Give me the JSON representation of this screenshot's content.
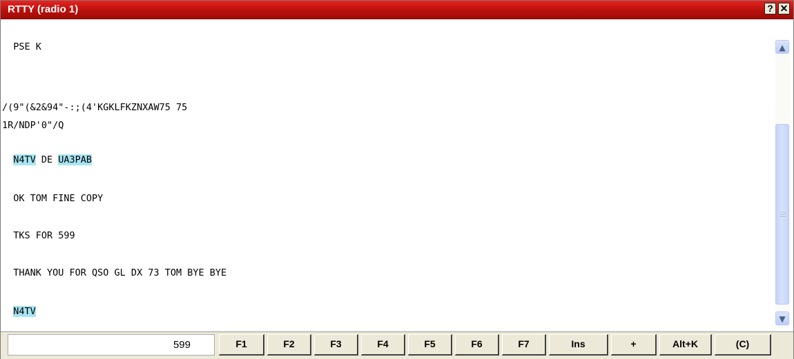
{
  "window": {
    "title": "RTTY (radio 1)",
    "help_glyph": "?",
    "close_glyph": "✕"
  },
  "receive_text": {
    "lines": [
      "  PSE K",
      "",
      "/(9\"(&2&94\"-:;(4'KGKLFKZNXAW75 75",
      "1R/NDP'0\"/Q",
      "",
      "  N4TV DE UA3PAB",
      "",
      "  OK TOM FINE COPY",
      "",
      "  TKS FOR 599",
      "",
      "  THANK YOU FOR QSO GL DX 73 TOM BYE BYE",
      "",
      "  N4TV"
    ],
    "highlighted_callsigns": [
      "N4TV",
      "UA3PAB"
    ],
    "highlight_color": "#a8e4f2"
  },
  "scrollbar": {
    "up_glyph": "▲",
    "down_glyph": "▼"
  },
  "bottom_bar": {
    "rst_value": "599",
    "keys": [
      "F1",
      "F2",
      "F3",
      "F4",
      "F5",
      "F6",
      "F7",
      "Ins",
      "+",
      "Alt+K",
      "(C)"
    ]
  },
  "colors": {
    "title_bar": "#c8150f",
    "toolbar_bg": "#ece9d8"
  }
}
